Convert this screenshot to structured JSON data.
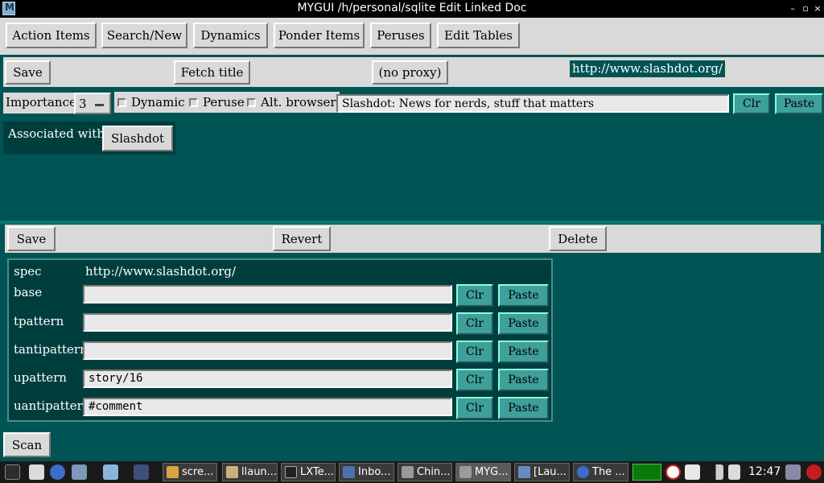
{
  "window": {
    "title": "MYGUI /h/personal/sqlite Edit Linked Doc",
    "min": "–",
    "max": "▫",
    "close": "×"
  },
  "menu": {
    "buttons": [
      "Action Items",
      "Search/New",
      "Dynamics",
      "Ponder Items",
      "Peruses",
      "Edit Tables"
    ]
  },
  "toolbar": {
    "save": "Save",
    "fetch_title": "Fetch title",
    "proxy": "(no proxy)",
    "url": "http://www.slashdot.org/"
  },
  "options": {
    "importance_label": "Importance:",
    "importance_value": "3",
    "dynamic": "Dynamic",
    "peruse": "Peruse",
    "alt_browser": "Alt. browser",
    "title_value": "Slashdot: News for nerds, stuff that matters",
    "clr": "Clr",
    "paste": "Paste"
  },
  "associated": {
    "label": "Associated with:",
    "item": "Slashdot"
  },
  "section": {
    "save": "Save",
    "revert": "Revert",
    "delete": "Delete"
  },
  "spec": {
    "label": "spec",
    "value": "http://www.slashdot.org/"
  },
  "rows": [
    {
      "label": "base",
      "value": "",
      "clr": "Clr",
      "paste": "Paste"
    },
    {
      "label": "tpattern",
      "value": "",
      "clr": "Clr",
      "paste": "Paste"
    },
    {
      "label": "tantipattern",
      "value": "",
      "clr": "Clr",
      "paste": "Paste"
    },
    {
      "label": "upattern",
      "value": "story/16",
      "clr": "Clr",
      "paste": "Paste"
    },
    {
      "label": "uantipattern",
      "value": "#comment",
      "clr": "Clr",
      "paste": "Paste"
    }
  ],
  "scan": "Scan",
  "taskbar": {
    "tasks": [
      "scre...",
      "llaun...",
      "LXTe...",
      "Inbo...",
      "Chin...",
      "MYG...",
      "[Lau...",
      "The ..."
    ],
    "clock": "12:47"
  },
  "colors": {
    "background": "#005454",
    "button": "#d9d9d9",
    "accent_button": "#3f9f9a",
    "label_bg": "#003e3e"
  }
}
